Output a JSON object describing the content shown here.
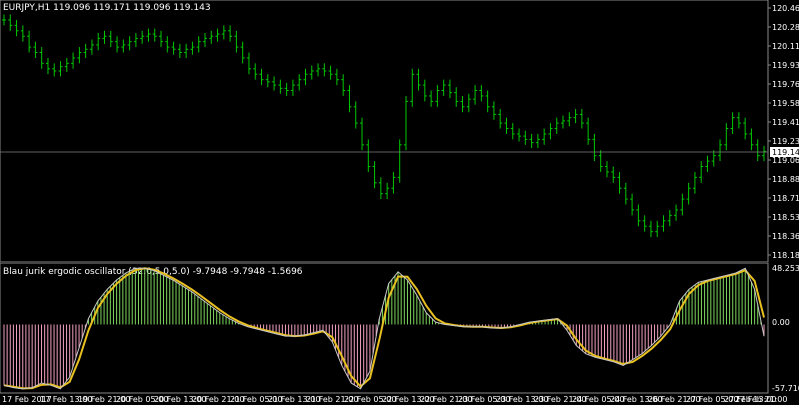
{
  "main_chart": {
    "title": "EURJPY,H1  119.096 119.171 119.096 119.143",
    "price_axis": [
      "120.460",
      "120.285",
      "120.110",
      "119.935",
      "119.760",
      "119.585",
      "119.410",
      "119.235",
      "119.060",
      "118.885",
      "118.710",
      "118.535",
      "118.360",
      "118.185"
    ],
    "current_price": "119.143",
    "colors": {
      "candle": "#00c800",
      "background": "#000000",
      "price_line": "#808080",
      "current_label_bg": "#ffffff"
    }
  },
  "indicator": {
    "title": "Blau jurik ergodic oscillator (32.0,5.0,5.0) -9.7948 -9.7948 -1.5696",
    "axis": [
      "48.2535",
      "0.00",
      "-57.7108"
    ],
    "colors": {
      "positive_hist": "#7cd65a",
      "negative_hist": "#f2a0c0",
      "signal": "#e8c020",
      "main": "#ffffff"
    }
  },
  "time_axis": [
    "17 Feb 2017",
    "17 Feb 13:00",
    "19 Feb 21:00",
    "20 Feb 05:00",
    "20 Feb 13:00",
    "20 Feb 21:00",
    "21 Feb 05:00",
    "21 Feb 13:00",
    "21 Feb 21:00",
    "22 Feb 05:00",
    "22 Feb 13:00",
    "22 Feb 21:00",
    "23 Feb 05:00",
    "23 Feb 13:00",
    "23 Feb 21:00",
    "24 Feb 05:00",
    "24 Feb 13:00",
    "26 Feb 21:00",
    "27 Feb 05:00",
    "27 Feb 13:00",
    "27 Feb 21:00"
  ],
  "chart_data": {
    "type": "line",
    "series": [
      {
        "name": "EURJPY,H1",
        "x_index_step": 1,
        "values": [
          120.35,
          120.3,
          120.25,
          120.2,
          120.1,
          120.05,
          119.95,
          119.9,
          119.88,
          119.92,
          119.95,
          120.0,
          120.05,
          120.08,
          120.12,
          120.18,
          120.2,
          120.15,
          120.1,
          120.12,
          120.15,
          120.18,
          120.2,
          120.22,
          120.2,
          120.15,
          120.1,
          120.08,
          120.05,
          120.08,
          120.1,
          120.15,
          120.18,
          120.2,
          120.22,
          120.25,
          120.2,
          120.1,
          120.0,
          119.9,
          119.85,
          119.8,
          119.78,
          119.75,
          119.72,
          119.7,
          119.75,
          119.8,
          119.85,
          119.88,
          119.9,
          119.88,
          119.85,
          119.8,
          119.7,
          119.55,
          119.4,
          119.2,
          119.0,
          118.85,
          118.75,
          118.8,
          118.9,
          119.2,
          119.6,
          119.85,
          119.75,
          119.65,
          119.6,
          119.7,
          119.75,
          119.68,
          119.6,
          119.55,
          119.62,
          119.7,
          119.65,
          119.55,
          119.48,
          119.4,
          119.35,
          119.3,
          119.28,
          119.25,
          119.22,
          119.25,
          119.3,
          119.35,
          119.4,
          119.42,
          119.45,
          119.48,
          119.4,
          119.25,
          119.1,
          119.0,
          118.95,
          118.9,
          118.8,
          118.7,
          118.6,
          118.5,
          118.45,
          118.4,
          118.45,
          118.5,
          118.55,
          118.6,
          118.7,
          118.8,
          118.9,
          119.0,
          119.05,
          119.1,
          119.2,
          119.35,
          119.45,
          119.4,
          119.3,
          119.2,
          119.1,
          119.14
        ]
      }
    ],
    "oscillator": [
      -52,
      -54,
      -55,
      -54,
      -50,
      -52,
      -55,
      -45,
      -20,
      5,
      20,
      30,
      38,
      44,
      48,
      48,
      46,
      42,
      38,
      33,
      28,
      22,
      16,
      10,
      5,
      1,
      -2,
      -4,
      -6,
      -8,
      -10,
      -10,
      -9,
      -7,
      -5,
      -15,
      -35,
      -50,
      -55,
      -40,
      5,
      35,
      45,
      38,
      25,
      10,
      2,
      0,
      -1,
      -2,
      -2,
      -2,
      -3,
      -3,
      -2,
      0,
      2,
      3,
      4,
      5,
      -5,
      -18,
      -25,
      -28,
      -30,
      -32,
      -35,
      -30,
      -25,
      -18,
      -10,
      0,
      20,
      30,
      36,
      38,
      40,
      42,
      44,
      48,
      30,
      -10
    ]
  }
}
